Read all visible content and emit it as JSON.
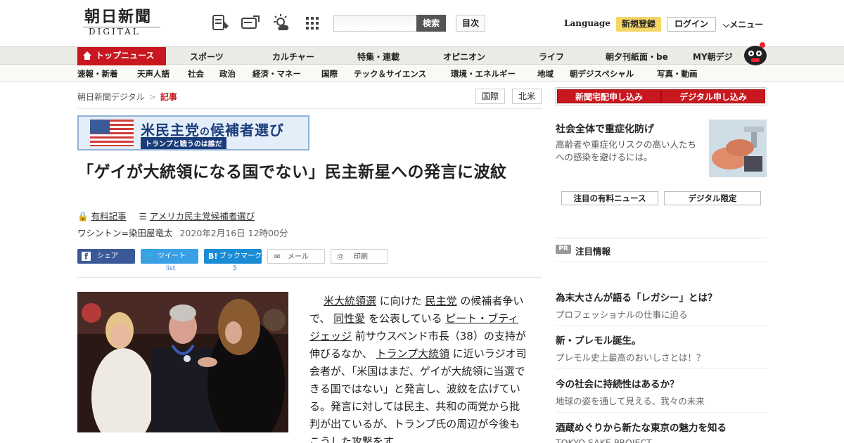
{
  "header": {
    "logo_jp": "朝日新聞",
    "logo_en": "DIGITAL",
    "search_placeholder": "",
    "search_button": "検索",
    "mokuji": "目次",
    "language": "Language",
    "register": "新規登録",
    "login": "ログイン",
    "menu": "メニュー"
  },
  "nav_primary": {
    "top": "トップニュース",
    "items": [
      "スポーツ",
      "カルチャー",
      "特集・連載",
      "オピニオン",
      "ライフ",
      "朝夕刊紙面・be",
      "MY朝デジ"
    ]
  },
  "nav_secondary": [
    "速報・新着",
    "天声人語",
    "社会",
    "政治",
    "経済・マネー",
    "国際",
    "テック＆サイエンス",
    "環境・エネルギー",
    "地域",
    "朝デジスペシャル",
    "写真・動画"
  ],
  "breadcrumb": {
    "home": "朝日新聞デジタル",
    "current": "記事",
    "separator": ">"
  },
  "tags": [
    "国際",
    "北米"
  ],
  "banner": {
    "title_a": "米民主党",
    "title_b": "の",
    "title_c": "候補者選び",
    "subtitle": "トランプと戦うのは誰だ"
  },
  "article": {
    "headline": "「ゲイが大統領になる国でない」民主新星への発言に波紋",
    "paid": "有料記事",
    "series": "アメリカ民主党候補者選び",
    "byline": "ワシントン=染田屋竜太",
    "date": "2020年2月16日 12時00分",
    "body": [
      {
        "t": "米大統領選",
        "u": true
      },
      {
        "t": " に向けた ",
        "u": false
      },
      {
        "t": "民主党",
        "u": true
      },
      {
        "t": " の候補者争いで、 ",
        "u": false
      },
      {
        "t": "同性愛",
        "u": true
      },
      {
        "t": " を公表している ",
        "u": false
      },
      {
        "t": "ピート・ブティジェッジ",
        "u": true
      },
      {
        "t": " 前サウスベンド市長（38）の支持が伸びるなか、 ",
        "u": false
      },
      {
        "t": "トランプ大統領",
        "u": true
      },
      {
        "t": " に近いラジオ司会者が、「米国はまだ、ゲイが大統領に当選できる国ではない」と発言し、波紋を広げている。発言に対しては民主、共和の両党から批判が出ているが、トランプ氏の周辺が今後もこうした攻撃をす",
        "u": false
      }
    ]
  },
  "social": {
    "facebook": "シェア",
    "twitter": "ツイート",
    "twitter_count": "list",
    "hatena": "ブックマーク",
    "hatena_count": "5",
    "mail": "メール",
    "print": "印刷"
  },
  "sidebar": {
    "subscribe_home": "新聞宅配申し込み",
    "subscribe_digital": "デジタル申し込み",
    "ad_title": "社会全体で重症化防げ",
    "ad_desc": "高齢者や重症化リスクの高い人たちへの感染を避けるには。",
    "tab1": "注目の有料ニュース",
    "tab2": "デジタル限定",
    "pr_badge": "PR",
    "pr_label": "注目情報",
    "pr_items": [
      {
        "title": "為末大さんが語る「レガシー」とは？",
        "desc": "プロフェッショナルの仕事に迫る"
      },
      {
        "title": "新・プレモル誕生。",
        "desc": "プレモル史上最高のおいしさとは！？"
      },
      {
        "title": "今の社会に持続性はあるか？",
        "desc": "地球の姿を通して見える、我々の未来"
      },
      {
        "title": "酒蔵めぐりから新たな東京の魅力を知る",
        "desc": "TOKYO SAKE PROJECT"
      }
    ]
  },
  "colors": {
    "brand_red": "#c8171e",
    "hatena_blue": "#1a8cd6",
    "facebook": "#3b5998",
    "twitter": "#3aa0e6"
  }
}
